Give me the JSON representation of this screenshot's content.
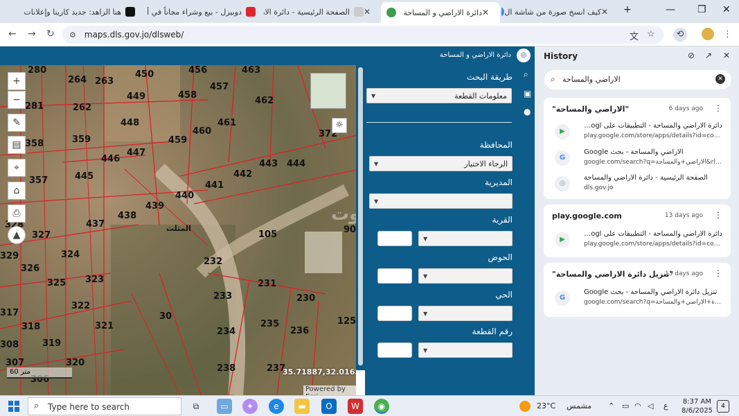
{
  "browser": {
    "tabs": [
      {
        "title": "هنا الزاهد: جديد كارينا وإعلانات",
        "favicon_color": "#111111"
      },
      {
        "title": "دوبيزل - بيع وشراء مجاناً في أ",
        "favicon_color": "#e0262b"
      },
      {
        "title": "الصفحة الرئيسية - دائرة الارا",
        "favicon_color": "#aaaaaa"
      },
      {
        "title": "دائرة الاراضي و المساحة",
        "favicon_color": "#3c9d4f"
      },
      {
        "title": "كيف انسخ صورة من شاشة ال",
        "favicon_color": "#4285f4"
      }
    ],
    "new_tab": "+",
    "url": "maps.dls.gov.jo/dlsweb/"
  },
  "app": {
    "brand": "دائرة الاراضي و المساحة",
    "logo_icon": "dls-logo-icon"
  },
  "map": {
    "parcels": [
      "280",
      "264",
      "263",
      "450",
      "456",
      "463",
      "281",
      "262",
      "449",
      "458",
      "457",
      "462",
      "448",
      "461",
      "460",
      "359",
      "459",
      "358",
      "447",
      "446",
      "445",
      "357",
      "443",
      "444",
      "442",
      "441",
      "440",
      "439",
      "438",
      "437",
      "90",
      "327",
      "105",
      "324",
      "329",
      "326",
      "232",
      "325",
      "323",
      "231",
      "322",
      "230",
      "233",
      "317",
      "30",
      "318",
      "321",
      "235",
      "125",
      "234",
      "236",
      "308",
      "319",
      "307",
      "320",
      "238",
      "237",
      "306",
      "372",
      "328"
    ],
    "road_label": "المثلث",
    "scale": "60 متر",
    "coords": "35.71887,32.01620",
    "powered_by": "Powered by Esri",
    "watermark": "بيوت"
  },
  "search_panel": {
    "method_label": "طريقة البحث",
    "method_value": "معلومات القطعة",
    "governorate_label": "المحافظة",
    "governorate_value": "الرجاء الاختيار",
    "directorate_label": "المديرية",
    "village_label": "القرية",
    "basin_label": "الحوض",
    "neighborhood_label": "الحي",
    "parcel_no_label": "رقم القطعة"
  },
  "history": {
    "title": "History",
    "search_value": "الاراضي والمساحة",
    "groups": [
      {
        "title": "\"الاراضي والمساحة\"",
        "ago": "6 days ago",
        "items": [
          {
            "title": "دائرة الاراضي والمساحة - التطبيقات على Googl",
            "url": "play.google.com/store/apps/details?id=com.info...",
            "icon": "google-play-icon",
            "favicon_color": "#34a853"
          },
          {
            "title": "الاراضي والمساحة - بحث Google",
            "url": "google.com/search?q=الاراضي+والمساحة&rlz=1C...",
            "icon": "google-icon",
            "favicon_color": "#4285f4"
          },
          {
            "title": "الصفحة الرئيسية - دائرة الاراضي والمساحة",
            "url": "dls.gov.jo",
            "icon": "dls-site-icon",
            "favicon_color": "#999999"
          }
        ]
      },
      {
        "title": "play.google.com",
        "ago": "13 days ago",
        "items": [
          {
            "title": "دائرة الاراضي والمساحة - التطبيقات على Googl",
            "url": "play.google.com/store/apps/details?id=com.info...",
            "icon": "google-play-icon",
            "favicon_color": "#34a853"
          }
        ]
      },
      {
        "title": "\"تنزيل دائرة الاراضي والمساحة\"",
        "ago": "13 days ago",
        "items": [
          {
            "title": "تنزيل دائرة الاراضي والمساحة - بحث Google",
            "url": "google.com/search?q=تنزيل+دائرة+الاراضي+والمساحة...",
            "icon": "google-icon",
            "favicon_color": "#4285f4"
          }
        ]
      }
    ]
  },
  "taskbar": {
    "search_placeholder": "Type here to search",
    "weather_temp": "23°C",
    "weather_text": "مشمس",
    "lang": "ع",
    "time": "8:37 AM",
    "date": "8/6/2025",
    "notifications": "4"
  }
}
